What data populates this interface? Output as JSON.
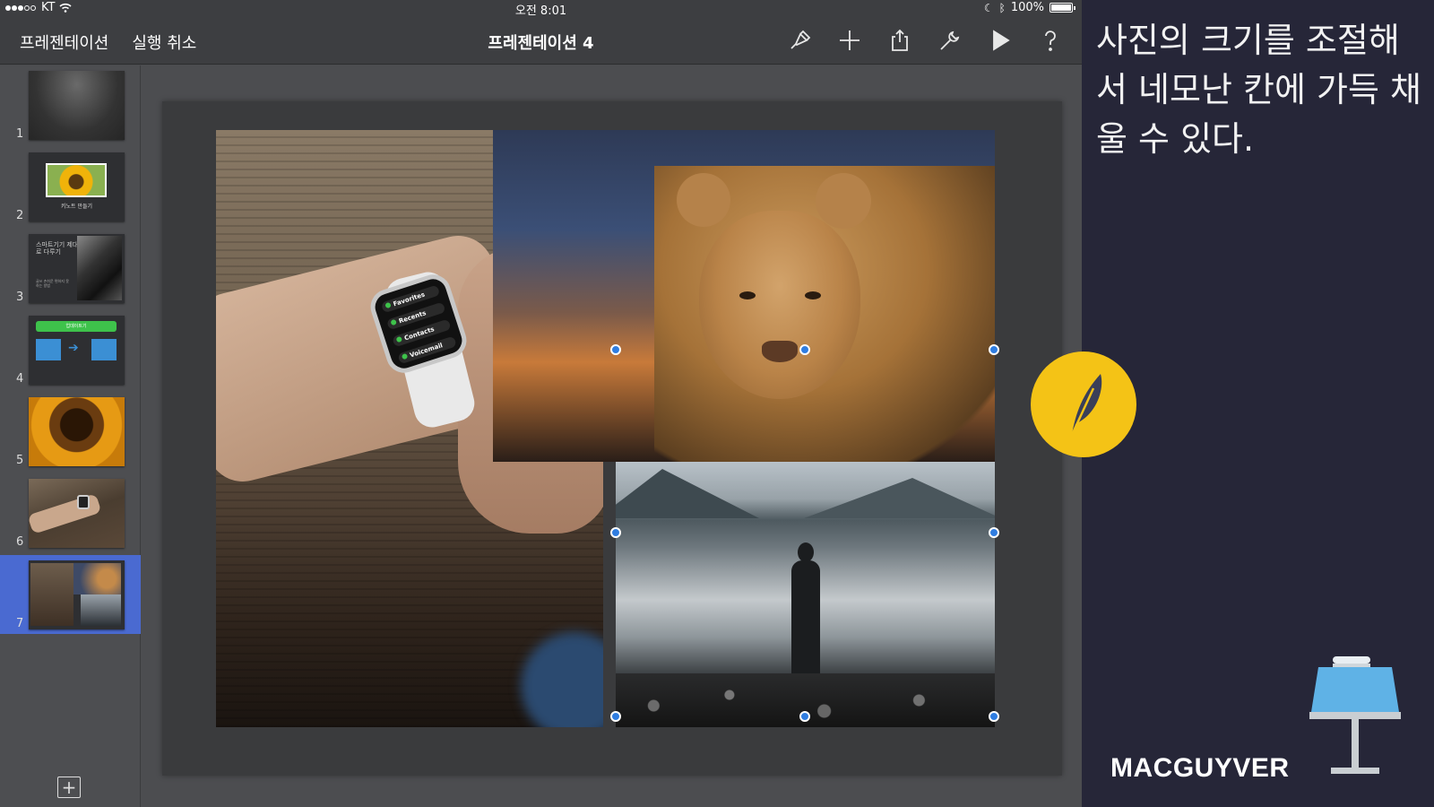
{
  "status_bar": {
    "carrier": "KT",
    "time": "오전 8:01",
    "battery": "100%"
  },
  "toolbar": {
    "back_label": "프레젠테이션",
    "undo_label": "실행 취소",
    "document_title": "프레젠테이션 4",
    "icons": [
      "format-brush-icon",
      "add-icon",
      "share-icon",
      "tools-wrench-icon",
      "play-icon",
      "help-icon"
    ]
  },
  "navigator": {
    "selected_slide": 7,
    "slides": [
      {
        "number": "1"
      },
      {
        "number": "2",
        "caption": "키노트 만들기"
      },
      {
        "number": "3",
        "title": "스마트기기 제대로 다루기",
        "subtitle": "글쓰 손쉬운 편하지 못하는 방법"
      },
      {
        "number": "4",
        "banner": "업데이트기"
      },
      {
        "number": "5"
      },
      {
        "number": "6"
      },
      {
        "number": "7"
      }
    ]
  },
  "slide": {
    "watch_screen_items": [
      "Favorites",
      "Recents",
      "Contacts",
      "Voicemail"
    ]
  },
  "panel": {
    "caption": "사진의 크기를 조절해 서 네모난 칸에 가득 채울 수 있다.",
    "brand": "MACGUYVER"
  },
  "colors": {
    "toolbar_bg": "#3d3e41",
    "selected_thumb": "#4a6ad1",
    "selection_handle": "#2f7de1",
    "badge_yellow": "#f4c316",
    "panel_bg": "#262638",
    "keynote_blue": "#5fb2e6"
  }
}
